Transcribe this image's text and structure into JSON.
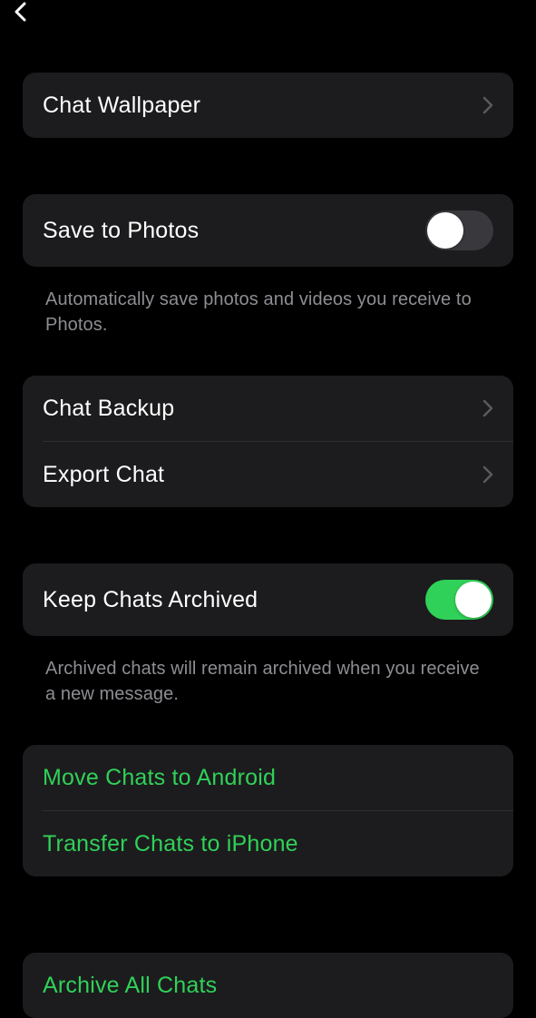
{
  "colors": {
    "accent": "#30d158",
    "bg": "#000000",
    "card": "#1c1c1e",
    "secondaryText": "#8d8d93"
  },
  "sections": {
    "wallpaper": {
      "label": "Chat Wallpaper"
    },
    "saveToPhotos": {
      "label": "Save to Photos",
      "toggle": false,
      "footer": "Automatically save photos and videos you receive to Photos."
    },
    "backup": {
      "items": [
        {
          "label": "Chat Backup"
        },
        {
          "label": "Export Chat"
        }
      ]
    },
    "keepArchived": {
      "label": "Keep Chats Archived",
      "toggle": true,
      "footer": "Archived chats will remain archived when you receive a new message."
    },
    "transfer": {
      "items": [
        {
          "label": "Move Chats to Android"
        },
        {
          "label": "Transfer Chats to iPhone"
        }
      ]
    },
    "archive": {
      "label": "Archive All Chats"
    }
  }
}
